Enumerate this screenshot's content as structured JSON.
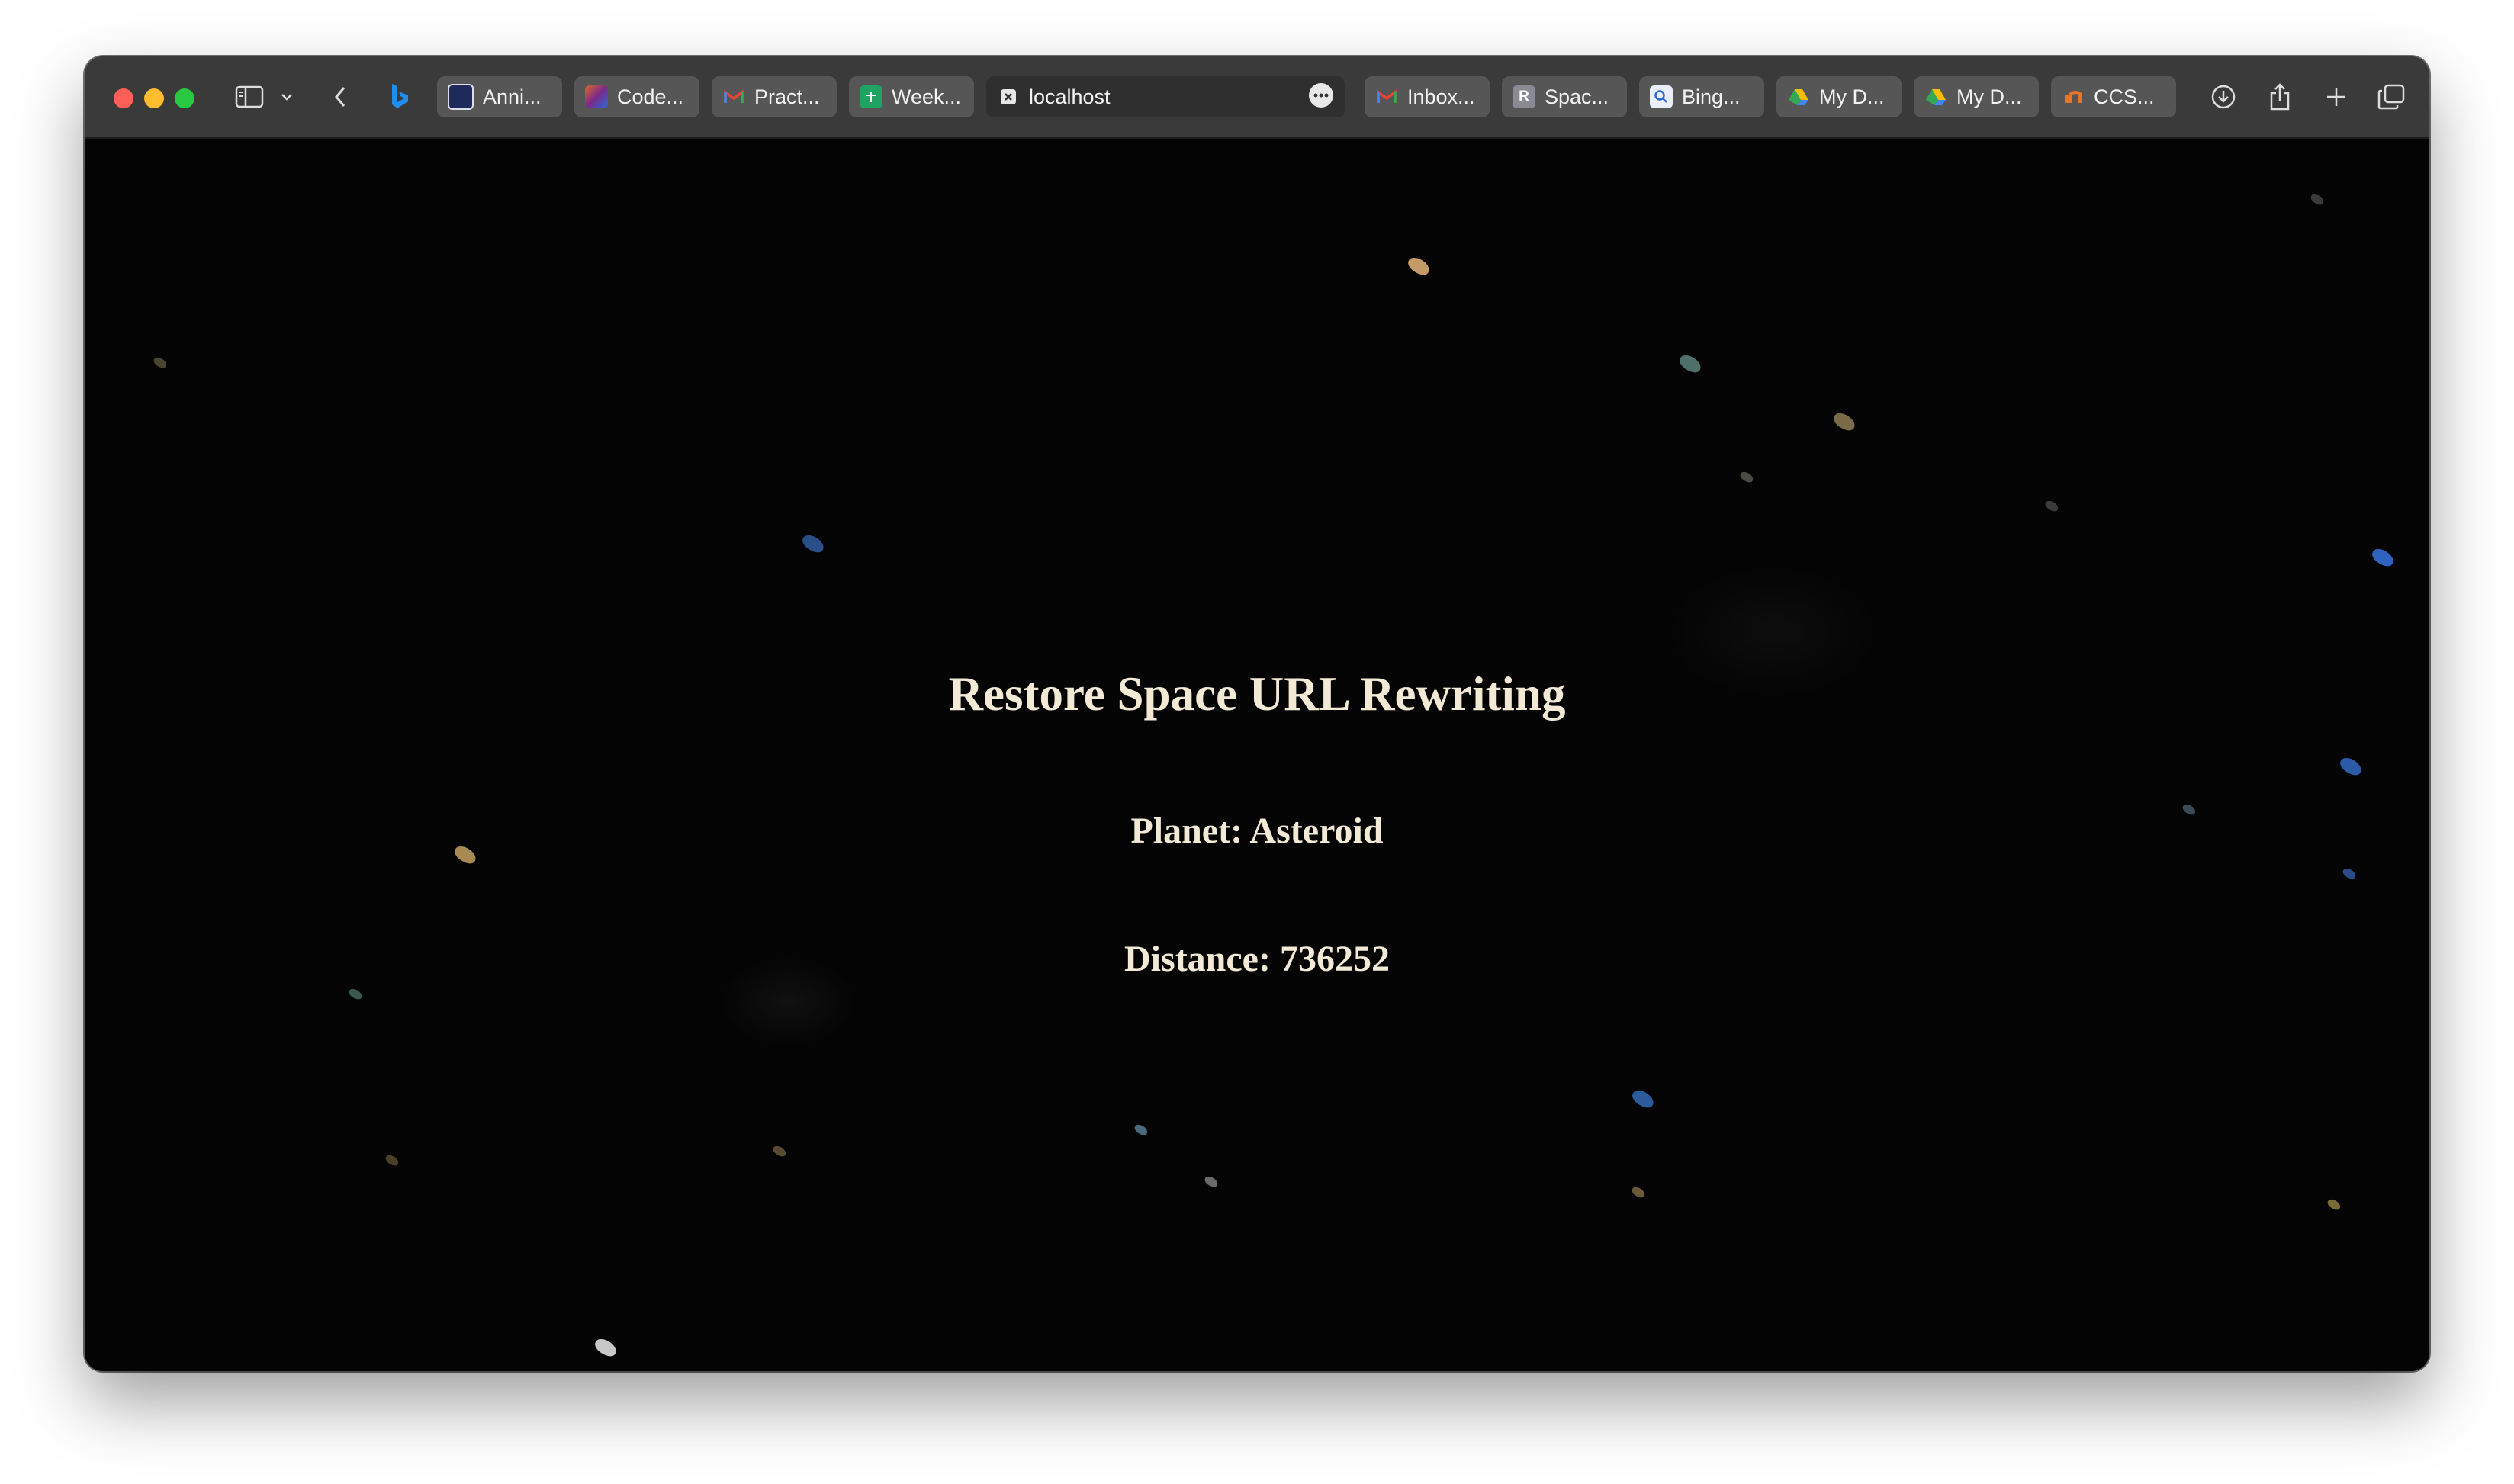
{
  "browser": {
    "tabs": [
      {
        "label": "Anni...",
        "icon": "bookmark-doc-icon"
      },
      {
        "label": "Code...",
        "icon": "codeium-icon"
      },
      {
        "label": "Pract...",
        "icon": "gmail-icon"
      },
      {
        "label": "Week...",
        "icon": "sheets-icon"
      },
      {
        "label": "localhost",
        "icon": "close-icon",
        "active": true
      },
      {
        "label": "Inbox...",
        "icon": "gmail-icon"
      },
      {
        "label": "Spac...",
        "icon": "r-letter-icon"
      },
      {
        "label": "Bing...",
        "icon": "bing-search-icon"
      },
      {
        "label": "My D...",
        "icon": "google-drive-icon"
      },
      {
        "label": "My D...",
        "icon": "google-drive-icon"
      },
      {
        "label": "CCS...",
        "icon": "ccs-icon"
      }
    ],
    "toolbar_icons": [
      "sidebar-icon",
      "chevron-down-icon",
      "back-icon",
      "bing-icon",
      "more-icon",
      "download-icon",
      "share-icon",
      "new-tab-icon",
      "tab-overview-icon"
    ]
  },
  "page": {
    "title": "Restore Space URL Rewriting",
    "planet": "Planet: Asteroid",
    "distance": "Distance: 736252"
  },
  "colors": {
    "background": "#040404",
    "text": "#f3ead6",
    "toolbar": "#3a3a3a"
  }
}
